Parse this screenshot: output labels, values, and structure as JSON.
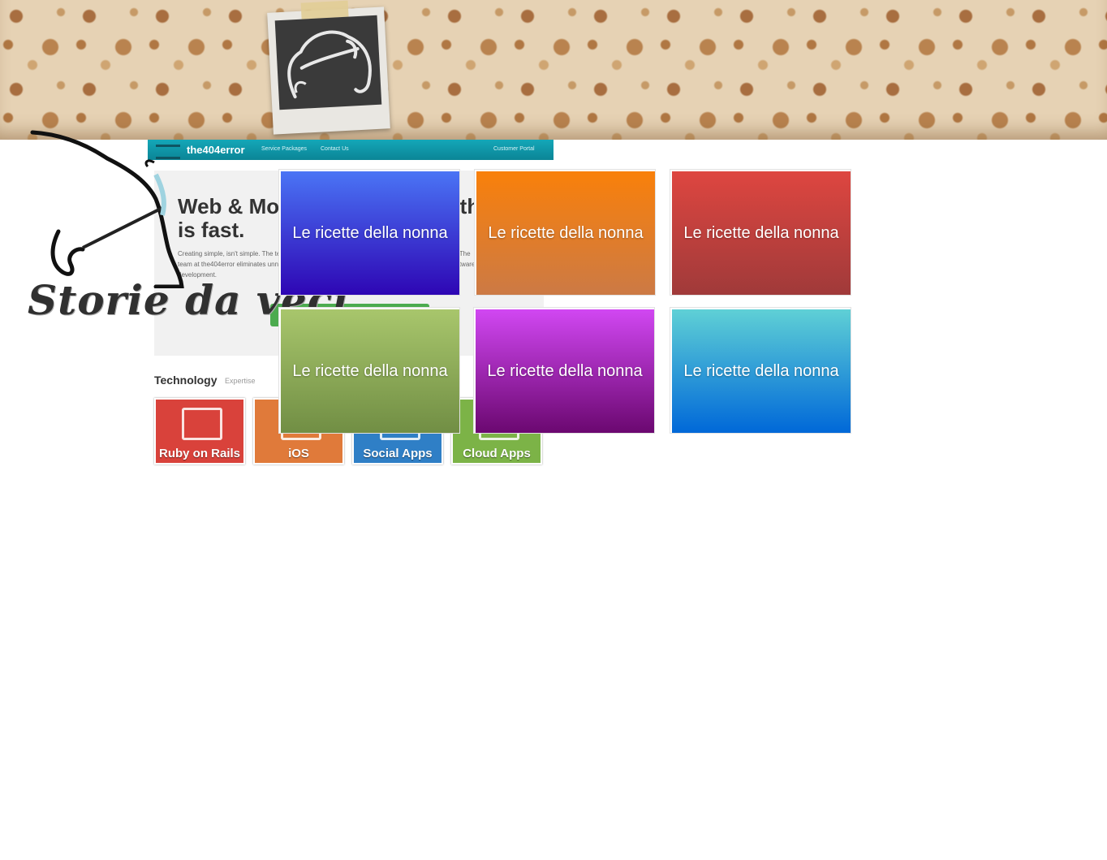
{
  "header": {
    "wallpaper": "floral-wallpaper"
  },
  "logo": {
    "polaroid_icon": "old-man-caricature-icon",
    "tagline": "Storie da veci"
  },
  "background_site": {
    "brand": "the404error",
    "nav": [
      "Service Packages",
      "Contact Us",
      "Customer Portal"
    ],
    "headline": "Web & Mobile Development that is fast.",
    "paragraph": "Creating simple, isn't simple. The technologies we use and the process. Everything we do is lean. The team at the404error eliminates unnecessary complexity and bring our clients amazingly simple software development.",
    "section_title": "Technology",
    "section_sub": "Expertise",
    "tech_tiles": [
      {
        "label": "Ruby on Rails",
        "color": "#d9423b"
      },
      {
        "label": "iOS",
        "color": "#e07a3a"
      },
      {
        "label": "Social Apps",
        "color": "#2f7fc6"
      },
      {
        "label": "Cloud Apps",
        "color": "#7cb347"
      }
    ]
  },
  "tiles": [
    {
      "label": "Le ricette della nonna",
      "color_top": "#4a74f5",
      "color_bottom": "#2e06b4"
    },
    {
      "label": "Le ricette della nonna",
      "color_top": "#f9800a",
      "color_bottom": "#cc7a45"
    },
    {
      "label": "Le ricette della nonna",
      "color_top": "#de4640",
      "color_bottom": "#a03a3a"
    },
    {
      "label": "Le ricette della nonna",
      "color_top": "#a8c66c",
      "color_bottom": "#718e44"
    },
    {
      "label": "Le ricette della nonna",
      "color_top": "#d147f2",
      "color_bottom": "#6b0870"
    },
    {
      "label": "Le ricette della nonna",
      "color_top": "#5fd0d6",
      "color_bottom": "#0068d8"
    }
  ]
}
